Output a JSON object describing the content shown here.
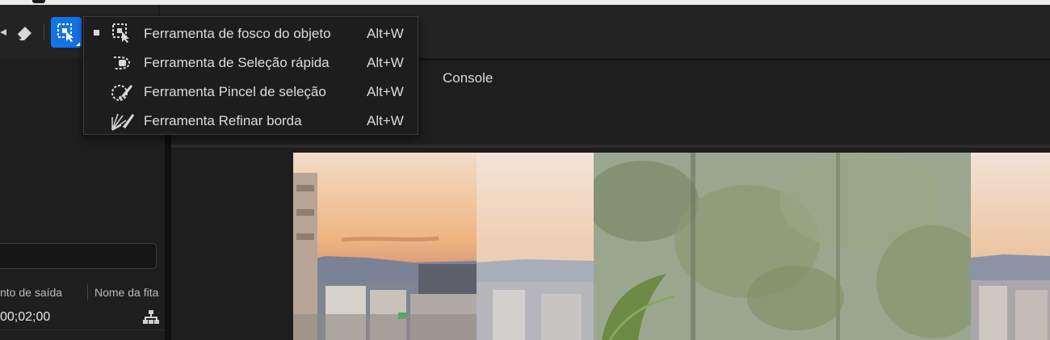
{
  "toolbar": {
    "active_tool": "object-matte-tool",
    "accent_color": "#1473e6"
  },
  "tool_menu": {
    "items": [
      {
        "label": "Ferramenta de fosco do objeto",
        "shortcut": "Alt+W",
        "icon": "object-matte-icon",
        "selected": true
      },
      {
        "label": "Ferramenta de Seleção rápida",
        "shortcut": "Alt+W",
        "icon": "quick-selection-icon",
        "selected": false
      },
      {
        "label": "Ferramenta Pincel de seleção",
        "shortcut": "Alt+W",
        "icon": "selection-brush-icon",
        "selected": false
      },
      {
        "label": "Ferramenta Refinar borda",
        "shortcut": "Alt+W",
        "icon": "refine-edge-icon",
        "selected": false
      }
    ]
  },
  "main": {
    "tab_label": "Console"
  },
  "left_panel": {
    "columns": [
      "nto de saída",
      "Nome da fita"
    ],
    "row_value": "00;02;00",
    "row_icon": "hierarchy-icon"
  }
}
